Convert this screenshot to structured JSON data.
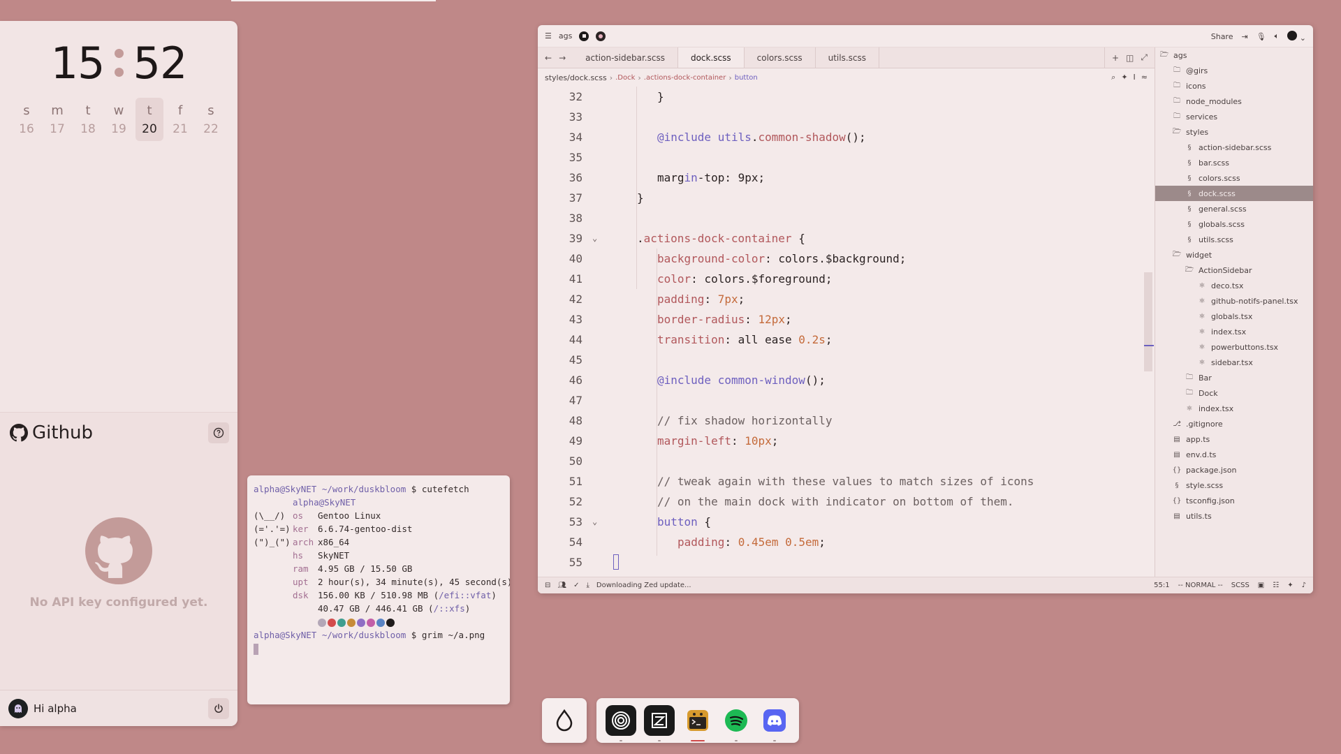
{
  "clock": {
    "hours": "15",
    "minutes": "52"
  },
  "calendar": [
    {
      "letter": "s",
      "num": "16",
      "today": false
    },
    {
      "letter": "m",
      "num": "17",
      "today": false
    },
    {
      "letter": "t",
      "num": "18",
      "today": false
    },
    {
      "letter": "w",
      "num": "19",
      "today": false
    },
    {
      "letter": "t",
      "num": "20",
      "today": true
    },
    {
      "letter": "f",
      "num": "21",
      "today": false
    },
    {
      "letter": "s",
      "num": "22",
      "today": false
    }
  ],
  "github": {
    "title": "Github",
    "message": "No API key configured yet."
  },
  "user": {
    "greeting": "Hi alpha"
  },
  "terminal": {
    "prompt_user": "alpha@SkyNET",
    "prompt_path": "~/work/duskbloom",
    "prompt_sign": "$",
    "cmd1": "cutefetch",
    "cmd2": "grim ~/a.png",
    "host_header": "alpha@SkyNET",
    "art": [
      "(\\__/)",
      "(='.'=)",
      "(\")_(\")"
    ],
    "rows": [
      {
        "key": "os",
        "value": "Gentoo Linux"
      },
      {
        "key": "ker",
        "value": "6.6.74-gentoo-dist"
      },
      {
        "key": "arch",
        "value": "x86_64"
      },
      {
        "key": "hs",
        "value": "SkyNET"
      },
      {
        "key": "ram",
        "value": "4.95 GB / 15.50 GB"
      },
      {
        "key": "upt",
        "value": "2 hour(s), 34 minute(s), 45 second(s)"
      }
    ],
    "disk_key": "dsk",
    "disk1_value": "156.00 KB / 510.98 MB (",
    "disk1_link": "/efi::vfat",
    "disk1_close": ")",
    "disk2_value": "40.47 GB / 446.41 GB (",
    "disk2_link": "/::xfs",
    "disk2_close": ")",
    "palette": [
      "#b3a7b7",
      "#d24b4b",
      "#3f9e8f",
      "#c68b39",
      "#8f6fc4",
      "#c25fa7",
      "#5a84c4",
      "#1f1b1b"
    ]
  },
  "editor": {
    "project": "ags",
    "share_label": "Share",
    "tabs": [
      "action-sidebar.scss",
      "dock.scss",
      "colors.scss",
      "utils.scss"
    ],
    "active_tab": 1,
    "breadcrumb": {
      "file": "styles/dock.scss",
      "sel1": ".Dock",
      "sel2": ".actions-dock-container",
      "sel3": "button"
    },
    "lines": [
      {
        "n": "32",
        "fold": "",
        "indent": 2,
        "html": "}"
      },
      {
        "n": "33",
        "fold": "",
        "indent": 0,
        "html": ""
      },
      {
        "n": "34",
        "fold": "",
        "indent": 2,
        "html": "<span class=\"c-kw\">@include</span> <span class=\"c-kw\">utils</span>.<span class=\"c-fn\">common-shadow</span>();"
      },
      {
        "n": "35",
        "fold": "",
        "indent": 0,
        "html": ""
      },
      {
        "n": "36",
        "fold": "",
        "indent": 2,
        "html": "marg<span class=\"c-kw\">in</span>-top: 9px;"
      },
      {
        "n": "37",
        "fold": "",
        "indent": 1,
        "html": "}"
      },
      {
        "n": "38",
        "fold": "",
        "indent": 0,
        "html": ""
      },
      {
        "n": "39",
        "fold": "⌄",
        "indent": 1,
        "html": ".<span class=\"c-fn\">actions-dock-container</span> {"
      },
      {
        "n": "40",
        "fold": "",
        "indent": 2,
        "html": "<span class=\"c-prop\">background-color</span>: colors.$background;"
      },
      {
        "n": "41",
        "fold": "",
        "indent": 2,
        "html": "<span class=\"c-prop\">color</span>: colors.$foreground;"
      },
      {
        "n": "42",
        "fold": "",
        "indent": 2,
        "html": "<span class=\"c-prop\">padding</span>: <span class=\"c-num\">7px</span>;"
      },
      {
        "n": "43",
        "fold": "",
        "indent": 2,
        "html": "<span class=\"c-prop\">border-radius</span>: <span class=\"c-num\">12px</span>;"
      },
      {
        "n": "44",
        "fold": "",
        "indent": 2,
        "html": "<span class=\"c-prop\">transition</span>: all ease <span class=\"c-num\">0.2s</span>;"
      },
      {
        "n": "45",
        "fold": "",
        "indent": 0,
        "html": ""
      },
      {
        "n": "46",
        "fold": "",
        "indent": 2,
        "html": "<span class=\"c-kw\">@include</span> <span class=\"c-kw\">common-window</span>();"
      },
      {
        "n": "47",
        "fold": "",
        "indent": 0,
        "html": ""
      },
      {
        "n": "48",
        "fold": "",
        "indent": 2,
        "html": "<span class=\"c-cmt\">// fix shadow horizontally</span>"
      },
      {
        "n": "49",
        "fold": "",
        "indent": 2,
        "html": "<span class=\"c-prop\">margin-left</span>: <span class=\"c-num\">10px</span>;"
      },
      {
        "n": "50",
        "fold": "",
        "indent": 0,
        "html": ""
      },
      {
        "n": "51",
        "fold": "",
        "indent": 2,
        "html": "<span class=\"c-cmt\">// tweak again with these values to match sizes of icons</span>"
      },
      {
        "n": "52",
        "fold": "",
        "indent": 2,
        "html": "<span class=\"c-cmt\">// on the main dock with indicator on bottom of them.</span>"
      },
      {
        "n": "53",
        "fold": "⌄",
        "indent": 2,
        "html": "<span class=\"c-kw\">button</span> {"
      },
      {
        "n": "54",
        "fold": "",
        "indent": 3,
        "html": "<span class=\"c-prop\">padding</span>: <span class=\"c-num\">0.45em 0.5em</span>;"
      },
      {
        "n": "55",
        "fold": "",
        "indent": 0,
        "html": ""
      }
    ],
    "status": {
      "message": "Downloading Zed update...",
      "position": "55:1",
      "mode": "-- NORMAL --",
      "language": "SCSS"
    },
    "tree": [
      {
        "label": "ags",
        "level": 0,
        "icon": "folder-open",
        "selected": false
      },
      {
        "label": "@girs",
        "level": 1,
        "icon": "folder",
        "selected": false
      },
      {
        "label": "icons",
        "level": 1,
        "icon": "folder",
        "selected": false
      },
      {
        "label": "node_modules",
        "level": 1,
        "icon": "folder",
        "selected": false
      },
      {
        "label": "services",
        "level": 1,
        "icon": "folder",
        "selected": false
      },
      {
        "label": "styles",
        "level": 1,
        "icon": "folder-open",
        "selected": false
      },
      {
        "label": "action-sidebar.scss",
        "level": 2,
        "icon": "scss",
        "selected": false
      },
      {
        "label": "bar.scss",
        "level": 2,
        "icon": "scss",
        "selected": false
      },
      {
        "label": "colors.scss",
        "level": 2,
        "icon": "scss",
        "selected": false
      },
      {
        "label": "dock.scss",
        "level": 2,
        "icon": "scss",
        "selected": true
      },
      {
        "label": "general.scss",
        "level": 2,
        "icon": "scss",
        "selected": false
      },
      {
        "label": "globals.scss",
        "level": 2,
        "icon": "scss",
        "selected": false
      },
      {
        "label": "utils.scss",
        "level": 2,
        "icon": "scss",
        "selected": false
      },
      {
        "label": "widget",
        "level": 1,
        "icon": "folder-open",
        "selected": false
      },
      {
        "label": "ActionSidebar",
        "level": 2,
        "icon": "folder-open",
        "selected": false
      },
      {
        "label": "deco.tsx",
        "level": 3,
        "icon": "react",
        "selected": false
      },
      {
        "label": "github-notifs-panel.tsx",
        "level": 3,
        "icon": "react",
        "selected": false
      },
      {
        "label": "globals.tsx",
        "level": 3,
        "icon": "react",
        "selected": false
      },
      {
        "label": "index.tsx",
        "level": 3,
        "icon": "react",
        "selected": false
      },
      {
        "label": "powerbuttons.tsx",
        "level": 3,
        "icon": "react",
        "selected": false
      },
      {
        "label": "sidebar.tsx",
        "level": 3,
        "icon": "react",
        "selected": false
      },
      {
        "label": "Bar",
        "level": 2,
        "icon": "folder",
        "selected": false
      },
      {
        "label": "Dock",
        "level": 2,
        "icon": "folder",
        "selected": false
      },
      {
        "label": "index.tsx",
        "level": 2,
        "icon": "react",
        "selected": false
      },
      {
        "label": ".gitignore",
        "level": 1,
        "icon": "git",
        "selected": false
      },
      {
        "label": "app.ts",
        "level": 1,
        "icon": "ts",
        "selected": false
      },
      {
        "label": "env.d.ts",
        "level": 1,
        "icon": "ts",
        "selected": false
      },
      {
        "label": "package.json",
        "level": 1,
        "icon": "json",
        "selected": false
      },
      {
        "label": "style.scss",
        "level": 1,
        "icon": "scss",
        "selected": false
      },
      {
        "label": "tsconfig.json",
        "level": 1,
        "icon": "json",
        "selected": false
      },
      {
        "label": "utils.ts",
        "level": 1,
        "icon": "ts",
        "selected": false
      }
    ]
  },
  "dock": {
    "launcher_icon": "droplet-icon",
    "apps": [
      {
        "name": "ring-launcher-icon",
        "color": "#1a1a1a",
        "active": false
      },
      {
        "name": "zed-editor-icon",
        "color": "#1a1a1a",
        "active": false
      },
      {
        "name": "terminal-icon",
        "color": "#2a2420",
        "active": true
      },
      {
        "name": "spotify-icon",
        "color": "#1db954",
        "active": false
      },
      {
        "name": "discord-icon",
        "color": "#5865f2",
        "active": false
      }
    ]
  }
}
